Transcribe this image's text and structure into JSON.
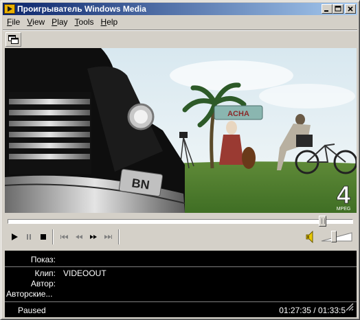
{
  "window": {
    "title": "Проигрыватель Windows Media"
  },
  "menu": [
    {
      "label": "File",
      "ul": "F",
      "rest": "ile"
    },
    {
      "label": "View",
      "ul": "V",
      "rest": "iew"
    },
    {
      "label": "Play",
      "ul": "P",
      "rest": "lay"
    },
    {
      "label": "Tools",
      "ul": "T",
      "rest": "ools"
    },
    {
      "label": "Help",
      "ul": "H",
      "rest": "elp"
    }
  ],
  "video": {
    "plate_text": "BN",
    "watermark": "MPEG",
    "watermark_digit": "4",
    "sign_text": "ACHA"
  },
  "seek": {
    "position_fraction": 0.92
  },
  "volume": {
    "level_fraction": 0.4
  },
  "info": {
    "show_label": "Показ:",
    "show_value": "",
    "clip_label": "Клип:",
    "clip_value": "VIDEOOUT",
    "author_label": "Автор:",
    "author_value": "",
    "copyright_label": "Авторские...",
    "copyright_value": "",
    "status": "Paused",
    "timecode": "01:27:35 / 01:33:5"
  },
  "icons": {
    "app": "media-player-icon",
    "compact": "compact-mode-icon",
    "play": "play-icon",
    "pause": "pause-icon",
    "stop": "stop-icon",
    "skip_back": "skip-back-icon",
    "rewind": "rewind-icon",
    "fast_forward": "fast-forward-icon",
    "skip_forward": "skip-forward-icon",
    "volume": "speaker-icon"
  }
}
